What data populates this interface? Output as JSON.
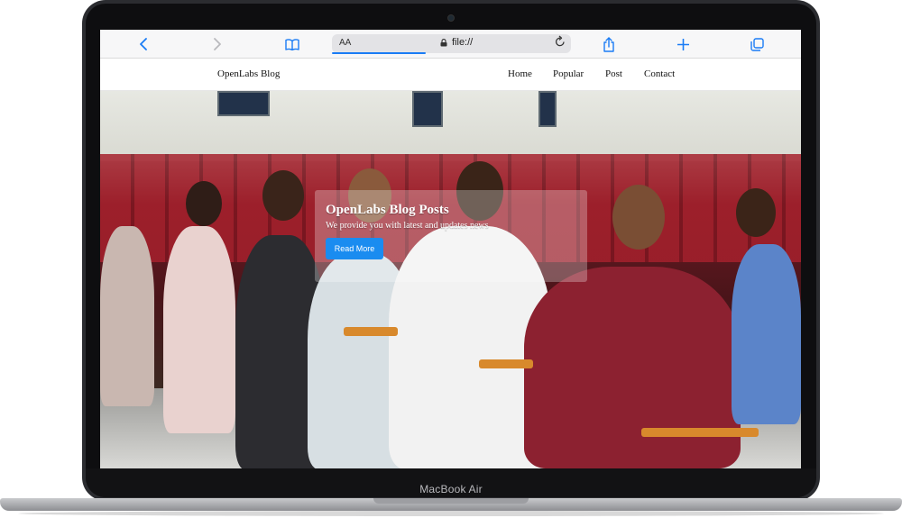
{
  "device": {
    "label": "MacBook Air"
  },
  "browser": {
    "text_size_label": "AA",
    "url": "file://",
    "icons": {
      "back": "chevron-left-icon",
      "forward": "chevron-right-icon",
      "bookmarks": "book-icon",
      "lock": "lock-icon",
      "reload": "reload-icon",
      "share": "share-icon",
      "new_tab": "plus-icon",
      "tabs": "tabs-icon"
    },
    "accent": "#1a7cf5"
  },
  "site": {
    "brand": "OpenLabs Blog",
    "nav": [
      "Home",
      "Popular",
      "Post",
      "Contact"
    ]
  },
  "hero": {
    "title": "OpenLabs Blog Posts",
    "subtitle": "We provide you with latest and updates news",
    "button_label": "Read More",
    "button_color": "#1a8cf0",
    "image": "audience-seated-in-red-auditorium-chairs-photo"
  }
}
